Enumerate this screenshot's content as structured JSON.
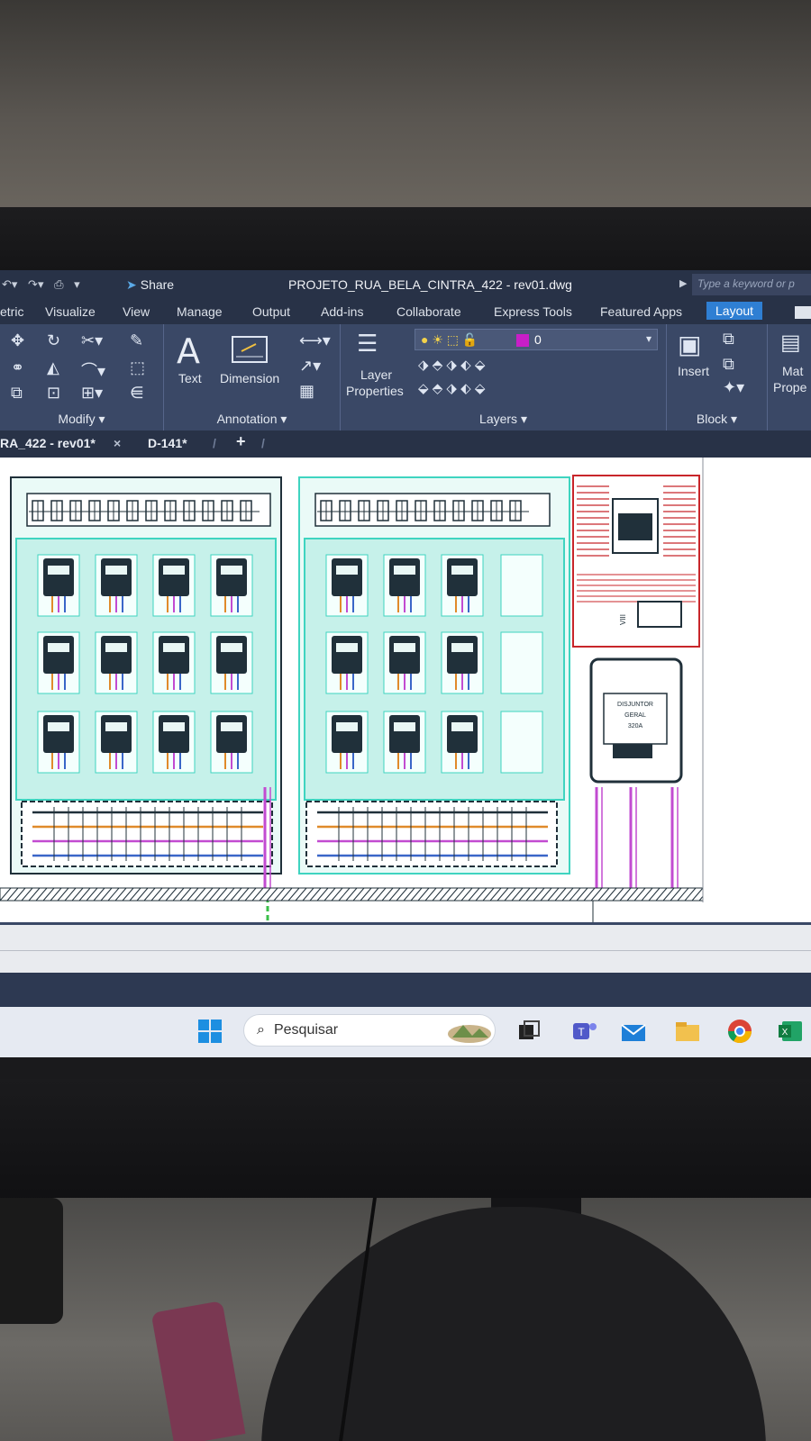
{
  "window": {
    "title": "PROJETO_RUA_BELA_CINTRA_422 - rev01.dwg",
    "share_label": "Share",
    "search_placeholder": "Type a keyword or p"
  },
  "ribbon_tabs": [
    {
      "label": "etric"
    },
    {
      "label": "Visualize"
    },
    {
      "label": "View"
    },
    {
      "label": "Manage"
    },
    {
      "label": "Output"
    },
    {
      "label": "Add-ins"
    },
    {
      "label": "Collaborate"
    },
    {
      "label": "Express Tools"
    },
    {
      "label": "Featured Apps"
    },
    {
      "label": "Layout",
      "active": true
    }
  ],
  "panels": {
    "modify": {
      "title": "Modify ▾"
    },
    "annotation": {
      "title": "Annotation ▾",
      "text_label": "Text",
      "dimension_label": "Dimension"
    },
    "layers": {
      "title": "Layers ▾",
      "layer_properties_label_1": "Layer",
      "layer_properties_label_2": "Properties",
      "current_layer": "0",
      "layer_color": "#c81ec8"
    },
    "block": {
      "title": "Block ▾",
      "insert_label": "Insert"
    },
    "properties": {
      "label_1": "Mat",
      "label_2": "Prope"
    }
  },
  "document_tabs": [
    {
      "label": "RA_422 - rev01*",
      "close": "×"
    },
    {
      "label": "D-141*"
    }
  ],
  "new_tab_label": "+",
  "drawing": {
    "breaker_label_1": "DISJUNTOR",
    "breaker_label_2": "GERAL",
    "breaker_rating": "320A",
    "vertical_label": "VIII",
    "colors": {
      "cyan": "#3fd4c0",
      "dark": "#20303a",
      "red": "#c8262a",
      "magenta": "#c24bd1",
      "green": "#3bbf4a"
    }
  },
  "taskbar": {
    "search_label": "Pesquisar",
    "apps": [
      "windows-start-icon",
      "widgets-icon",
      "task-view-icon",
      "teams-icon",
      "mail-icon",
      "file-explorer-icon",
      "chrome-icon",
      "excel-icon"
    ]
  }
}
